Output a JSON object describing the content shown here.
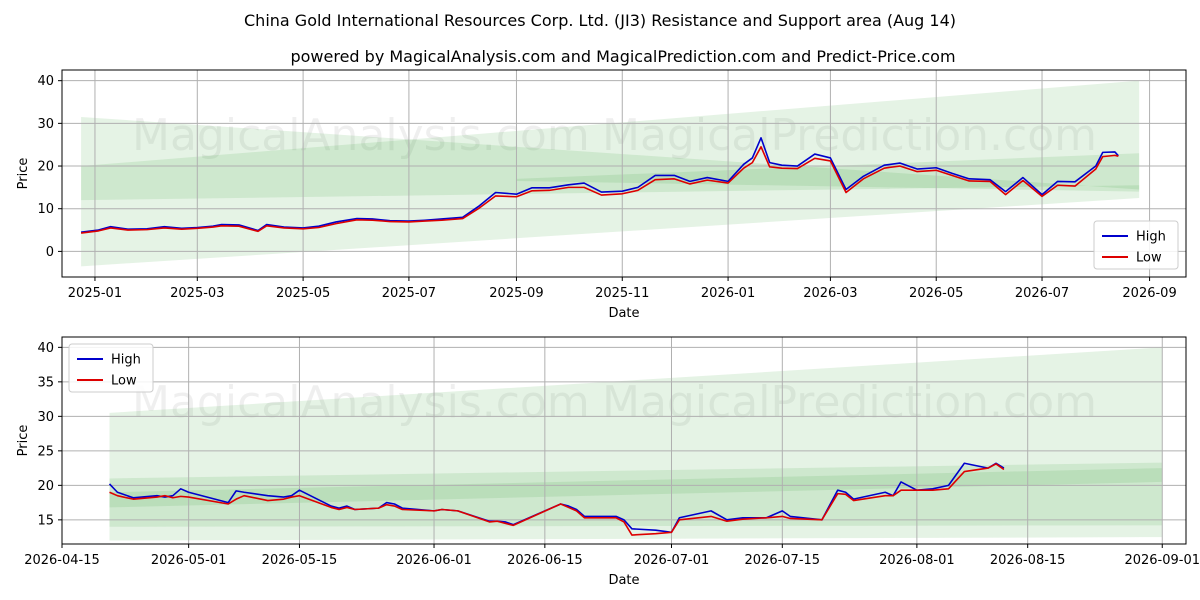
{
  "title_line1": "China Gold International Resources Corp. Ltd. (JI3) Resistance and Support area (Aug 14)",
  "title_line2": "powered by MagicalAnalysis.com and MagicalPrediction.com and Predict-Price.com",
  "watermarks": [
    "MagicalAnalysis.com",
    "MagicalPrediction.com"
  ],
  "colors": {
    "high": "#0000cc",
    "low": "#dd0000",
    "band": "#2ca02c",
    "grid": "#b0b0b0"
  },
  "chart_data": [
    {
      "type": "line",
      "xlabel": "Date",
      "ylabel": "Price",
      "xlim": [
        "2024-12-13",
        "2026-09-22"
      ],
      "ylim": [
        -6,
        42.5
      ],
      "x_ticks": [
        "2025-01",
        "2025-03",
        "2025-05",
        "2025-07",
        "2025-09",
        "2025-11",
        "2026-01",
        "2026-03",
        "2026-05",
        "2026-07",
        "2026-09"
      ],
      "y_ticks": [
        0,
        10,
        20,
        30,
        40
      ],
      "grid": true,
      "legend_position": "lower-right",
      "bands": [
        {
          "x": [
            "2024-12-24",
            "2026-08-26"
          ],
          "upper": [
            31.5,
            14.5
          ],
          "lower": [
            12.0,
            15.5
          ]
        },
        {
          "x": [
            "2024-12-24",
            "2026-08-26"
          ],
          "upper": [
            20.0,
            40.0
          ],
          "lower": [
            -3.5,
            12.5
          ]
        },
        {
          "x": [
            "2025-09-01",
            "2026-08-26"
          ],
          "upper": [
            17.0,
            23.0
          ],
          "lower": [
            16.5,
            14.0
          ]
        }
      ],
      "series": [
        {
          "name": "High",
          "x": [
            "2024-12-24",
            "2025-01-03",
            "2025-01-10",
            "2025-01-20",
            "2025-01-31",
            "2025-02-10",
            "2025-02-20",
            "2025-03-01",
            "2025-03-10",
            "2025-03-15",
            "2025-03-25",
            "2025-04-05",
            "2025-04-10",
            "2025-04-20",
            "2025-05-01",
            "2025-05-10",
            "2025-05-20",
            "2025-06-01",
            "2025-06-10",
            "2025-06-20",
            "2025-07-01",
            "2025-07-10",
            "2025-07-20",
            "2025-08-01",
            "2025-08-10",
            "2025-08-20",
            "2025-09-01",
            "2025-09-10",
            "2025-09-20",
            "2025-10-01",
            "2025-10-10",
            "2025-10-20",
            "2025-11-01",
            "2025-11-10",
            "2025-11-20",
            "2025-12-01",
            "2025-12-10",
            "2025-12-20",
            "2026-01-01",
            "2026-01-10",
            "2026-01-15",
            "2026-01-20",
            "2026-01-25",
            "2026-02-01",
            "2026-02-10",
            "2026-02-20",
            "2026-03-01",
            "2026-03-10",
            "2026-03-20",
            "2026-04-01",
            "2026-04-10",
            "2026-04-20",
            "2026-05-01",
            "2026-05-10",
            "2026-05-20",
            "2026-06-01",
            "2026-06-10",
            "2026-06-20",
            "2026-07-01",
            "2026-07-10",
            "2026-07-20",
            "2026-08-01",
            "2026-08-05",
            "2026-08-12",
            "2026-08-14"
          ],
          "values": [
            4.5,
            5.0,
            5.8,
            5.2,
            5.3,
            5.8,
            5.4,
            5.6,
            5.9,
            6.3,
            6.2,
            4.9,
            6.3,
            5.7,
            5.5,
            5.9,
            6.9,
            7.7,
            7.6,
            7.2,
            7.1,
            7.3,
            7.6,
            8.0,
            10.5,
            13.8,
            13.4,
            14.9,
            14.9,
            15.6,
            16.0,
            13.9,
            14.1,
            15.0,
            17.8,
            17.8,
            16.4,
            17.3,
            16.4,
            20.4,
            21.9,
            26.6,
            20.8,
            20.2,
            20.0,
            22.8,
            21.9,
            14.5,
            17.6,
            20.2,
            20.7,
            19.3,
            19.6,
            18.3,
            17.0,
            16.8,
            14.0,
            17.3,
            13.3,
            16.4,
            16.3,
            20.0,
            23.2,
            23.3,
            22.4
          ]
        },
        {
          "name": "Low",
          "x": [
            "2024-12-24",
            "2025-01-03",
            "2025-01-10",
            "2025-01-20",
            "2025-01-31",
            "2025-02-10",
            "2025-02-20",
            "2025-03-01",
            "2025-03-10",
            "2025-03-15",
            "2025-03-25",
            "2025-04-05",
            "2025-04-10",
            "2025-04-20",
            "2025-05-01",
            "2025-05-10",
            "2025-05-20",
            "2025-06-01",
            "2025-06-10",
            "2025-06-20",
            "2025-07-01",
            "2025-07-10",
            "2025-07-20",
            "2025-08-01",
            "2025-08-10",
            "2025-08-20",
            "2025-09-01",
            "2025-09-10",
            "2025-09-20",
            "2025-10-01",
            "2025-10-10",
            "2025-10-20",
            "2025-11-01",
            "2025-11-10",
            "2025-11-20",
            "2025-12-01",
            "2025-12-10",
            "2025-12-20",
            "2026-01-01",
            "2026-01-10",
            "2026-01-15",
            "2026-01-20",
            "2026-01-25",
            "2026-02-01",
            "2026-02-10",
            "2026-02-20",
            "2026-03-01",
            "2026-03-10",
            "2026-03-20",
            "2026-04-01",
            "2026-04-10",
            "2026-04-20",
            "2026-05-01",
            "2026-05-10",
            "2026-05-20",
            "2026-06-01",
            "2026-06-10",
            "2026-06-20",
            "2026-07-01",
            "2026-07-10",
            "2026-07-20",
            "2026-08-01",
            "2026-08-05",
            "2026-08-12",
            "2026-08-14"
          ],
          "values": [
            4.3,
            4.8,
            5.5,
            5.0,
            5.1,
            5.5,
            5.2,
            5.4,
            5.7,
            6.0,
            5.9,
            4.7,
            6.0,
            5.5,
            5.3,
            5.6,
            6.5,
            7.4,
            7.3,
            7.0,
            6.9,
            7.1,
            7.3,
            7.7,
            10.0,
            13.0,
            12.8,
            14.2,
            14.3,
            15.0,
            15.0,
            13.2,
            13.5,
            14.3,
            16.8,
            17.0,
            15.8,
            16.7,
            16.0,
            19.5,
            20.8,
            24.5,
            19.8,
            19.5,
            19.4,
            21.8,
            21.2,
            13.8,
            17.0,
            19.5,
            20.0,
            18.7,
            19.0,
            17.8,
            16.5,
            16.4,
            13.3,
            16.6,
            12.9,
            15.5,
            15.3,
            19.3,
            22.2,
            22.5,
            22.3
          ]
        }
      ]
    },
    {
      "type": "line",
      "xlabel": "Date",
      "ylabel": "Price",
      "xlim": [
        "2026-04-15",
        "2026-09-04"
      ],
      "ylim": [
        11.5,
        41.5
      ],
      "x_ticks": [
        "2026-04-15",
        "2026-05-01",
        "2026-05-15",
        "2026-06-01",
        "2026-06-15",
        "2026-07-01",
        "2026-07-15",
        "2026-08-01",
        "2026-08-15",
        "2026-09-01"
      ],
      "y_ticks": [
        15,
        20,
        25,
        30,
        35,
        40
      ],
      "grid": true,
      "legend_position": "upper-left",
      "bands": [
        {
          "x": [
            "2026-04-21",
            "2026-09-01"
          ],
          "upper": [
            30.5,
            40.0
          ],
          "lower": [
            12.0,
            12.5
          ]
        },
        {
          "x": [
            "2026-04-21",
            "2026-09-01"
          ],
          "upper": [
            21.0,
            23.3
          ],
          "lower": [
            14.0,
            14.2
          ]
        },
        {
          "x": [
            "2026-04-21",
            "2026-09-01"
          ],
          "upper": [
            19.0,
            22.5
          ],
          "lower": [
            16.8,
            20.5
          ]
        }
      ],
      "series": [
        {
          "name": "High",
          "x": [
            "2026-04-21",
            "2026-04-22",
            "2026-04-24",
            "2026-04-27",
            "2026-04-28",
            "2026-04-29",
            "2026-04-30",
            "2026-05-01",
            "2026-05-06",
            "2026-05-07",
            "2026-05-08",
            "2026-05-11",
            "2026-05-13",
            "2026-05-14",
            "2026-05-15",
            "2026-05-19",
            "2026-05-20",
            "2026-05-21",
            "2026-05-22",
            "2026-05-25",
            "2026-05-26",
            "2026-05-27",
            "2026-05-28",
            "2026-06-01",
            "2026-06-02",
            "2026-06-04",
            "2026-06-08",
            "2026-06-09",
            "2026-06-10",
            "2026-06-11",
            "2026-06-17",
            "2026-06-18",
            "2026-06-19",
            "2026-06-20",
            "2026-06-24",
            "2026-06-25",
            "2026-06-26",
            "2026-06-29",
            "2026-07-01",
            "2026-07-02",
            "2026-07-06",
            "2026-07-08",
            "2026-07-10",
            "2026-07-13",
            "2026-07-15",
            "2026-07-16",
            "2026-07-20",
            "2026-07-22",
            "2026-07-23",
            "2026-07-24",
            "2026-07-28",
            "2026-07-29",
            "2026-07-30",
            "2026-08-01",
            "2026-08-03",
            "2026-08-05",
            "2026-08-07",
            "2026-08-10",
            "2026-08-11",
            "2026-08-12"
          ],
          "values": [
            20.2,
            19.0,
            18.2,
            18.5,
            18.3,
            18.5,
            19.5,
            19.0,
            17.5,
            19.2,
            19.0,
            18.5,
            18.3,
            18.5,
            19.3,
            17.0,
            16.7,
            17.0,
            16.5,
            16.7,
            17.5,
            17.3,
            16.7,
            16.3,
            16.5,
            16.3,
            14.8,
            14.8,
            14.7,
            14.3,
            17.3,
            17.0,
            16.5,
            15.5,
            15.5,
            15.0,
            13.7,
            13.5,
            13.2,
            15.3,
            16.3,
            15.0,
            15.3,
            15.3,
            16.3,
            15.5,
            15.0,
            19.3,
            19.0,
            18.0,
            19.0,
            18.5,
            20.5,
            19.3,
            19.5,
            20.0,
            23.2,
            22.5,
            23.2,
            22.5
          ]
        },
        {
          "name": "Low",
          "x": [
            "2026-04-21",
            "2026-04-22",
            "2026-04-24",
            "2026-04-27",
            "2026-04-28",
            "2026-04-29",
            "2026-04-30",
            "2026-05-01",
            "2026-05-06",
            "2026-05-07",
            "2026-05-08",
            "2026-05-11",
            "2026-05-13",
            "2026-05-14",
            "2026-05-15",
            "2026-05-19",
            "2026-05-20",
            "2026-05-21",
            "2026-05-22",
            "2026-05-25",
            "2026-05-26",
            "2026-05-27",
            "2026-05-28",
            "2026-06-01",
            "2026-06-02",
            "2026-06-04",
            "2026-06-08",
            "2026-06-09",
            "2026-06-10",
            "2026-06-11",
            "2026-06-17",
            "2026-06-18",
            "2026-06-19",
            "2026-06-20",
            "2026-06-24",
            "2026-06-25",
            "2026-06-26",
            "2026-06-29",
            "2026-07-01",
            "2026-07-02",
            "2026-07-06",
            "2026-07-08",
            "2026-07-10",
            "2026-07-13",
            "2026-07-15",
            "2026-07-16",
            "2026-07-20",
            "2026-07-22",
            "2026-07-23",
            "2026-07-24",
            "2026-07-28",
            "2026-07-29",
            "2026-07-30",
            "2026-08-01",
            "2026-08-03",
            "2026-08-05",
            "2026-08-07",
            "2026-08-10",
            "2026-08-11",
            "2026-08-12"
          ],
          "values": [
            19.0,
            18.5,
            18.0,
            18.3,
            18.5,
            18.2,
            18.4,
            18.3,
            17.3,
            18.0,
            18.5,
            17.8,
            18.0,
            18.3,
            18.5,
            16.8,
            16.5,
            16.8,
            16.5,
            16.7,
            17.2,
            17.0,
            16.5,
            16.3,
            16.5,
            16.3,
            14.7,
            14.8,
            14.5,
            14.2,
            17.3,
            16.8,
            16.3,
            15.3,
            15.3,
            14.7,
            12.8,
            13.0,
            13.2,
            15.0,
            15.5,
            14.8,
            15.1,
            15.3,
            15.5,
            15.2,
            15.0,
            18.8,
            18.7,
            17.8,
            18.5,
            18.5,
            19.3,
            19.3,
            19.3,
            19.5,
            22.0,
            22.5,
            23.1,
            22.3
          ]
        }
      ]
    }
  ],
  "legend": {
    "high_label": "High",
    "low_label": "Low"
  }
}
